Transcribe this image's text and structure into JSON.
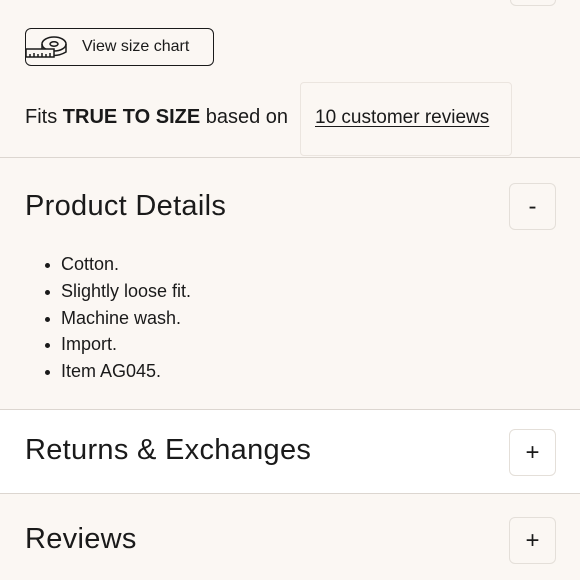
{
  "size_chart": {
    "button_label": "View size chart",
    "icon": "measuring-tape-icon"
  },
  "fit": {
    "prefix": "Fits ",
    "emphasis": "TRUE TO SIZE",
    "middle": " based on",
    "reviews_link": "10 customer reviews"
  },
  "product_details": {
    "title": "Product Details",
    "toggle": "-",
    "items": [
      "Cotton.",
      "Slightly loose fit.",
      "Machine wash.",
      "Import.",
      "Item AG045."
    ]
  },
  "returns": {
    "title": "Returns & Exchanges",
    "toggle": "+"
  },
  "reviews": {
    "title": "Reviews",
    "toggle": "+"
  }
}
